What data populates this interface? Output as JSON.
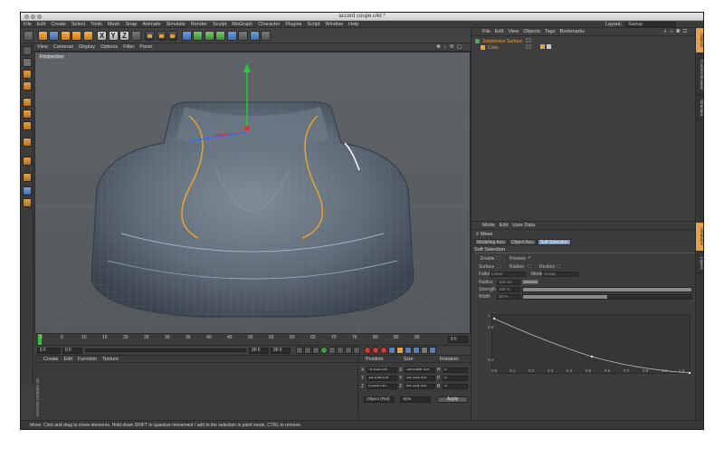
{
  "window": {
    "title": "accord coupe.c4d *"
  },
  "menubar": {
    "items": [
      "File",
      "Edit",
      "Create",
      "Select",
      "Tools",
      "Mesh",
      "Snap",
      "Animate",
      "Simulate",
      "Render",
      "Sculpt",
      "MoGraph",
      "Character",
      "Plugins",
      "Script",
      "Window",
      "Help"
    ],
    "layout_label": "Layout:",
    "layout_value": "Startup"
  },
  "viewport": {
    "menu": [
      "View",
      "Cameras",
      "Display",
      "Options",
      "Filter",
      "Panel"
    ],
    "label": "Perspective",
    "nav_icons": "✥ ↕ ⟲ ▢"
  },
  "timeline": {
    "ticks": [
      "0",
      "5",
      "10",
      "15",
      "20",
      "25",
      "30",
      "35",
      "40",
      "45",
      "50",
      "55",
      "60",
      "65",
      "70",
      "75",
      "80",
      "85",
      "90"
    ],
    "end_frame": "0 F"
  },
  "transport": {
    "current_frame": "0 F",
    "range_start": "0 F",
    "range_end": "90 F",
    "max_frame": "90 F"
  },
  "material_manager": {
    "menu": [
      "Create",
      "Edit",
      "Function",
      "Texture"
    ],
    "brand": "MAXON CINEMA 4D"
  },
  "coordinates": {
    "head_position": "Position",
    "head_size": "Size",
    "head_rotation": "Rotation",
    "rows": [
      {
        "axis": "X",
        "pos": "-4.415 cm",
        "size_axis": "X",
        "size": "194.559 cm",
        "rot_axis": "H",
        "rot": "0 °"
      },
      {
        "axis": "Y",
        "pos": "15.236 cm",
        "size_axis": "Y",
        "size": "33.343 cm",
        "rot_axis": "P",
        "rot": "0 °"
      },
      {
        "axis": "Z",
        "pos": "0.225 cm",
        "size_axis": "Z",
        "size": "81.115 cm",
        "rot_axis": "B",
        "rot": "0 °"
      }
    ],
    "mode": "Object (Rel)",
    "size_mode": "Size",
    "apply": "Apply"
  },
  "status": {
    "text": "Move: Click and drag to move elements. Hold down SHIFT to quantize movement / add to the selection in point mode, CTRL to remove."
  },
  "object_manager": {
    "menu": [
      "File",
      "Edit",
      "View",
      "Objects",
      "Tags",
      "Bookmarks"
    ],
    "objects": [
      {
        "name": "Subdivision Surface"
      },
      {
        "name": "Cube"
      }
    ]
  },
  "attributes": {
    "menu": [
      "Mode",
      "Edit",
      "User Data"
    ],
    "title": "Move",
    "tabs": [
      "Modeling Axis",
      "Object Axis",
      "Soft Selection"
    ],
    "section": "Soft Selection",
    "enable": "Enable",
    "preview": "Preview",
    "surface": "Surface",
    "rubber": "Rubber",
    "restrict": "Restrict",
    "falloff_label": "Falloff",
    "falloff_value": "Linear",
    "mode_label": "Mode",
    "mode_value": "Group",
    "radius_label": "Radius",
    "radius_value": "100 cm",
    "strength_label": "Strength",
    "strength_value": "100 %",
    "width_label": "Width",
    "width_value": "50 %",
    "strength_level": 1.0,
    "width_level": 0.5,
    "graph_y": [
      "1",
      "0.8",
      "0.4"
    ],
    "graph_x": [
      "0.0",
      "0.1",
      "0.2",
      "0.3",
      "0.4",
      "0.5",
      "0.6",
      "0.7",
      "0.8",
      "0.9",
      "1.0"
    ]
  },
  "side_tabs": [
    "Objects",
    "Content Browser",
    "Structure",
    "Attributes",
    "Layers"
  ],
  "colors": {
    "accent_orange": "#e5a24b",
    "selection_curve": "#f0a52a",
    "axis_y": "#27c93f",
    "axis_x": "#e0302c",
    "axis_z": "#3b6cf0",
    "tab_active": "#6b8fc4"
  }
}
